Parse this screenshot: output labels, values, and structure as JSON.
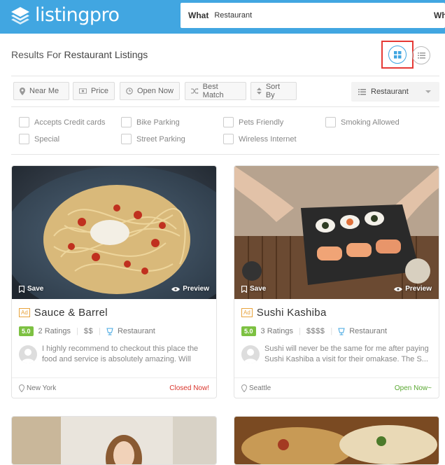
{
  "header": {
    "logo_text": "listingpro",
    "search_what_label": "What",
    "search_what_value": "Restaurant",
    "search_where_label": "Wh"
  },
  "results": {
    "prefix": "Results For ",
    "query": "Restaurant Listings"
  },
  "filters": {
    "near_me": "Near Me",
    "price": "Price",
    "open_now": "Open Now",
    "best_match": "Best Match",
    "sort_by": "Sort By",
    "category": "Restaurant"
  },
  "features": [
    "Accepts Credit cards",
    "Bike Parking",
    "Pets Friendly",
    "Smoking Allowed",
    "Special",
    "Street Parking",
    "Wireless Internet"
  ],
  "cards": [
    {
      "save": "Save",
      "preview": "Preview",
      "ad": "Ad",
      "title": "Sauce & Barrel",
      "rating": "5.0",
      "ratings_count": "2 Ratings",
      "price": "$$",
      "category": "Restaurant",
      "review": "I highly recommend to checkout this place the food and service is absolutely amazing. Will",
      "location": "New York",
      "status": "Closed Now!"
    },
    {
      "save": "Save",
      "preview": "Preview",
      "ad": "Ad",
      "title": "Sushi Kashiba",
      "rating": "5.0",
      "ratings_count": "3 Ratings",
      "price": "$$$$",
      "category": "Restaurant",
      "review": "Sushi will never be the same for me after paying Sushi Kashiba a visit for their omakase. The S...",
      "location": "Seattle",
      "status": "Open Now~"
    }
  ],
  "colors": {
    "brand": "#41a6e1",
    "rating": "#7dc142",
    "closed": "#d9342b",
    "open": "#5aa832",
    "highlight": "#e53935"
  }
}
